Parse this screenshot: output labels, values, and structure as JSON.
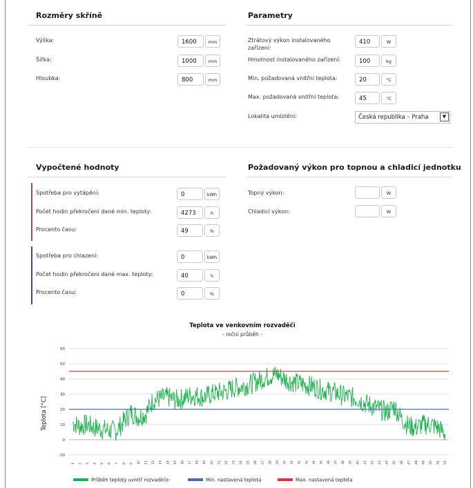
{
  "cabinet": {
    "title": "Rozměry skříně",
    "fields": [
      {
        "label": "Výška:",
        "value": "1600",
        "unit": "mm"
      },
      {
        "label": "Šířka:",
        "value": "1000",
        "unit": "mm"
      },
      {
        "label": "Hloubka:",
        "value": "800",
        "unit": "mm"
      }
    ]
  },
  "params": {
    "title": "Parametry",
    "fields": [
      {
        "label": "Ztrátový výkon instalovaného zařízení:",
        "value": "410",
        "unit": "W"
      },
      {
        "label": "Hmotnost instalovaného zařízení:",
        "value": "100",
        "unit": "kg"
      },
      {
        "label": "Min. požadovaná vnitřní teplota:",
        "value": "20",
        "unit": "°C"
      },
      {
        "label": "Max. požadovaná vnitřní teplota:",
        "value": "45",
        "unit": "°C"
      }
    ],
    "location_label": "Lokalita umístění:",
    "location_value": "Česká republika – Praha"
  },
  "computed": {
    "title": "Vypočtené hodnoty",
    "heating": [
      {
        "label": "Spotřeba pro vytápění:",
        "value": "0",
        "unit": "kWh"
      },
      {
        "label": "Počet hodin překročení dané min. teploty:",
        "value": "4273",
        "unit": "h"
      },
      {
        "label": "Procento času:",
        "value": "49",
        "unit": "%"
      }
    ],
    "cooling": [
      {
        "label": "Spotřeba pro chlazení:",
        "value": "0",
        "unit": "kWh"
      },
      {
        "label": "Počet hodin překročení dané max. teploty:",
        "value": "40",
        "unit": "h"
      },
      {
        "label": "Procento času:",
        "value": "0",
        "unit": "%"
      }
    ],
    "heating_color": "#b14a4a",
    "cooling_color": "#3b4a8a"
  },
  "required": {
    "title": "Požadovaný výkon pro topnou a chladicí jednotku",
    "fields": [
      {
        "label": "Topný výkon:",
        "value": "",
        "unit": "W"
      },
      {
        "label": "Chladicí výkon:",
        "value": "",
        "unit": "W"
      }
    ]
  },
  "chart_data": {
    "type": "line",
    "title": "Teplota ve venkovním rozvaděči",
    "subtitle": "- roční průběh -",
    "ylabel": "Teplota [°C]",
    "xlabel": "",
    "ylim": [
      -10,
      60
    ],
    "yticks": [
      -10,
      0,
      10,
      20,
      30,
      40,
      50,
      60
    ],
    "xticks": [
      "1",
      "2",
      "3",
      "4",
      "5",
      "6",
      "7",
      "8",
      "9",
      "10",
      "11",
      "12",
      "13",
      "14",
      "15",
      "16",
      "17",
      "18",
      "19",
      "20",
      "21",
      "22",
      "23",
      "24",
      "25",
      "26",
      "27",
      "28",
      "29",
      "30",
      "31",
      "32",
      "33",
      "34",
      "35",
      "36",
      "37",
      "38",
      "39",
      "40",
      "41",
      "42",
      "43",
      "44",
      "45",
      "46",
      "47",
      "48",
      "49",
      "50",
      "51",
      "52"
    ],
    "grid": true,
    "legend_position": "bottom",
    "series": [
      {
        "name": "Průběh teploty uvnitř rozvaděče",
        "color": "#1fb04f",
        "weekly_avg": [
          11,
          9,
          10,
          8,
          7,
          6,
          6,
          12,
          18,
          15,
          17,
          26,
          27,
          28,
          26,
          27,
          29,
          29,
          28,
          30,
          31,
          32,
          34,
          35,
          36,
          38,
          40,
          42,
          43,
          40,
          38,
          37,
          36,
          35,
          33,
          32,
          31,
          29,
          28,
          27,
          24,
          22,
          20,
          18,
          22,
          14,
          9,
          8,
          10,
          10,
          8,
          4
        ]
      },
      {
        "name": "Min. nastavená teplota",
        "color": "#4a6ea8",
        "value": 20
      },
      {
        "name": "Max. nastavená teplota",
        "color": "#d23a3a",
        "value": 45
      }
    ]
  }
}
